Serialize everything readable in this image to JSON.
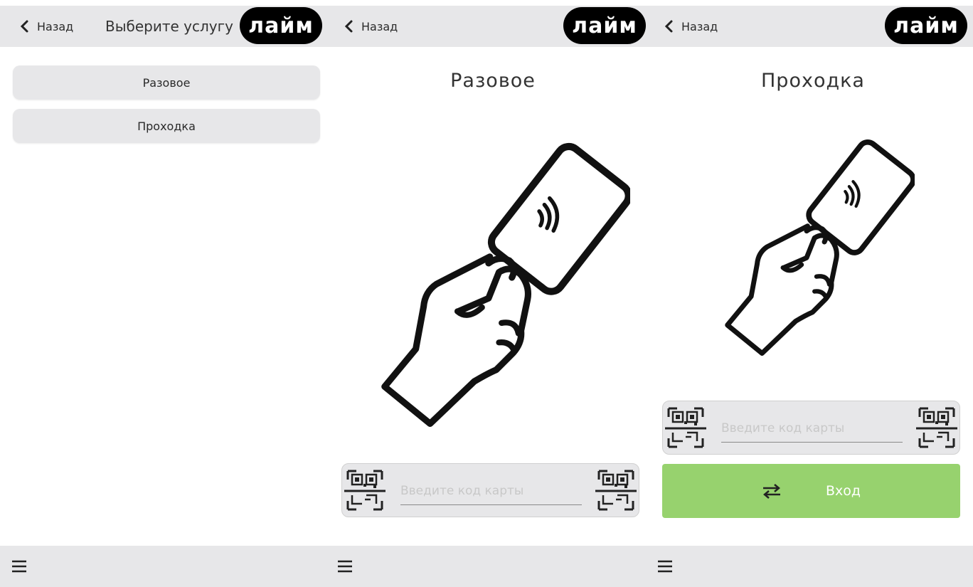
{
  "screens": [
    {
      "back_label": "Назад",
      "title": "Выберите услугу",
      "logo_text": "лайм",
      "services": [
        "Разовое",
        "Проходка"
      ]
    },
    {
      "back_label": "Назад",
      "logo_text": "лайм",
      "title": "Разовое",
      "card_placeholder": "Введите код карты",
      "card_value": ""
    },
    {
      "back_label": "Назад",
      "logo_text": "лайм",
      "title": "Проходка",
      "card_placeholder": "Введите код карты",
      "card_value": "",
      "enter_label": "Вход"
    }
  ],
  "colors": {
    "bar_bg": "#e7e7e9",
    "enter_button": "#97d26e",
    "logo_bg": "#000000",
    "logo_accent": "#8fd35a"
  },
  "icons": [
    "chevron-left-icon",
    "menu-icon",
    "qr-scan-icon",
    "swap-arrows-icon",
    "hand-card-nfc-icon"
  ]
}
